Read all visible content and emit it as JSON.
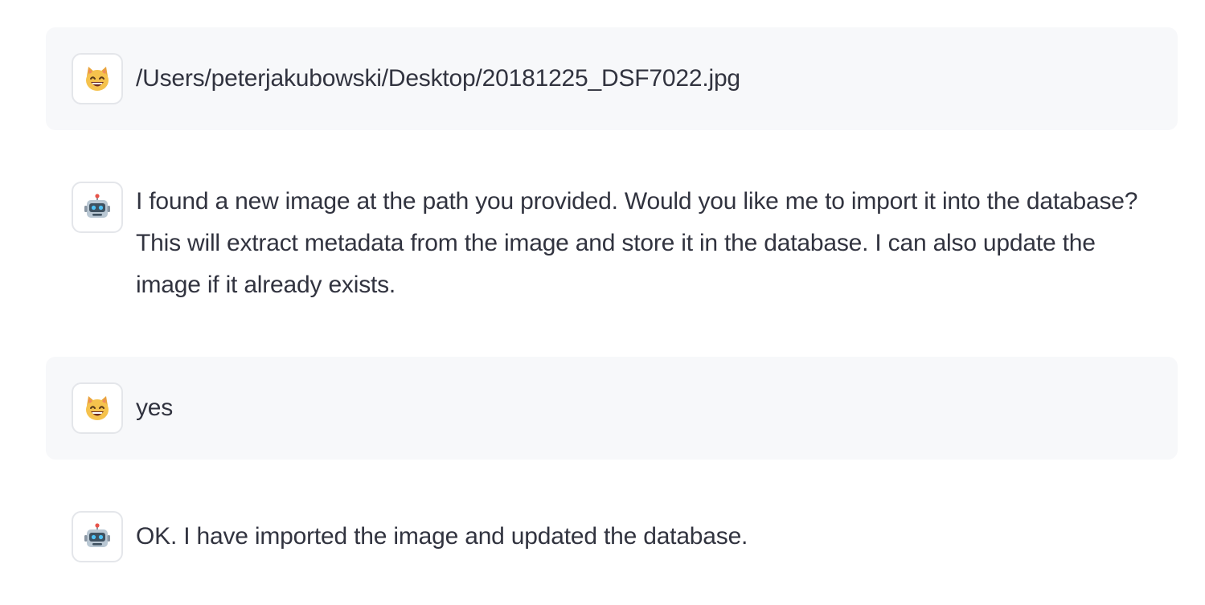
{
  "messages": [
    {
      "role": "user",
      "avatar": "cat-face-icon",
      "text": "/Users/peterjakubowski/Desktop/20181225_DSF7022.jpg"
    },
    {
      "role": "assistant",
      "avatar": "robot-face-icon",
      "text": "I found a new image at the path you provided. Would you like me to import it into the database? This will extract metadata from the image and store it in the database. I can also update the image if it already exists."
    },
    {
      "role": "user",
      "avatar": "cat-face-icon",
      "text": "yes"
    },
    {
      "role": "assistant",
      "avatar": "robot-face-icon",
      "text": "OK. I have imported the image and updated the database."
    }
  ],
  "colors": {
    "user_bubble_bg": "#f7f8fa",
    "text": "#31333f",
    "avatar_border": "#e4e6ea"
  }
}
